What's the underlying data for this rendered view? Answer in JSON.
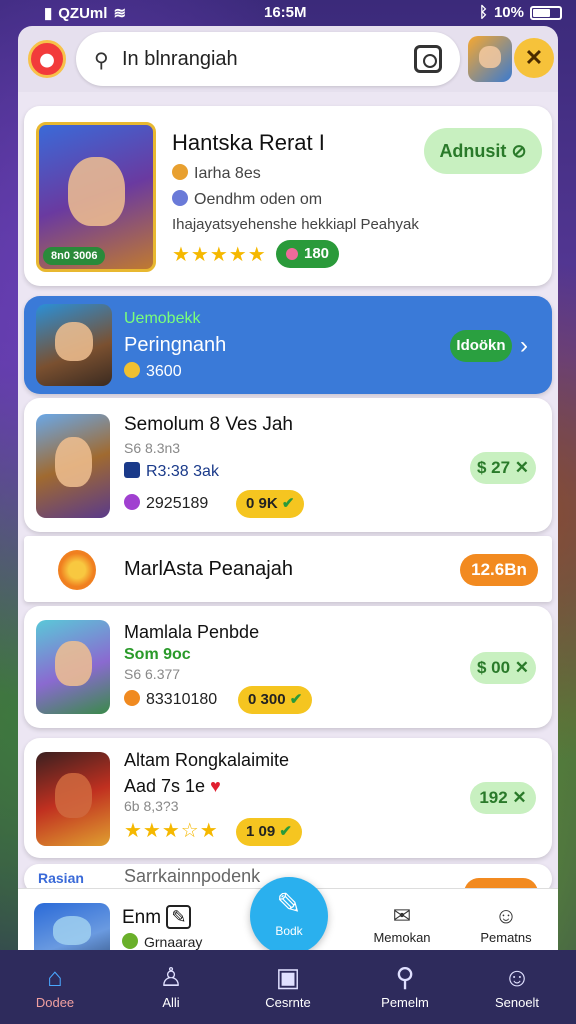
{
  "status": {
    "carrier": "QZUml",
    "time": "16:5M",
    "battery": "10%"
  },
  "search": {
    "value": "In blnrangiah"
  },
  "cards": {
    "featured": {
      "title": "Hantska Rerat I",
      "line1": "Iarha 8es",
      "line2": "Oendhm oden om",
      "line3": "Ihajayatsyehenshe hekkiapl Peahyak",
      "badge": "8n0 3006",
      "rating_pill": "180",
      "button": "Adnusit"
    },
    "banner": {
      "small": "Uemobekk",
      "title": "Peringnanh",
      "meta": "3600",
      "button": "Idoökn"
    },
    "item1": {
      "title": "Semolum 8 Ves Jah",
      "price_sub": "S6 8.3n3",
      "meta": "R3:38 3ak",
      "count": "2925189",
      "pill": "0 9K",
      "price": "$ 27"
    },
    "row": {
      "title": "MarlAsta Peanajah",
      "price": "12.6Bn"
    },
    "item2": {
      "title": "Mamlala Penbde",
      "line2": "Som 9oc",
      "price_sub": "S6 6.377",
      "count": "83310180",
      "pill": "0 300",
      "price": "$ 00"
    },
    "item3": {
      "title": "Altam Rongkalaimite",
      "line2": "Aad 7s 1e",
      "price_sub": "6b 8,3?3",
      "pill": "1 09",
      "price": "192"
    },
    "partial": {
      "tag": "Rasian",
      "title": "Sarrkainnpodenk"
    }
  },
  "bottom": {
    "title": "Enm",
    "sub": "Grnaaray",
    "fab": "Bodk",
    "tab1": "Memokan",
    "tab2": "Pematns"
  },
  "nav": [
    {
      "label": "Dodee"
    },
    {
      "label": "Alli"
    },
    {
      "label": "Cesrnte"
    },
    {
      "label": "Pemelm"
    },
    {
      "label": "Senoelt"
    }
  ]
}
